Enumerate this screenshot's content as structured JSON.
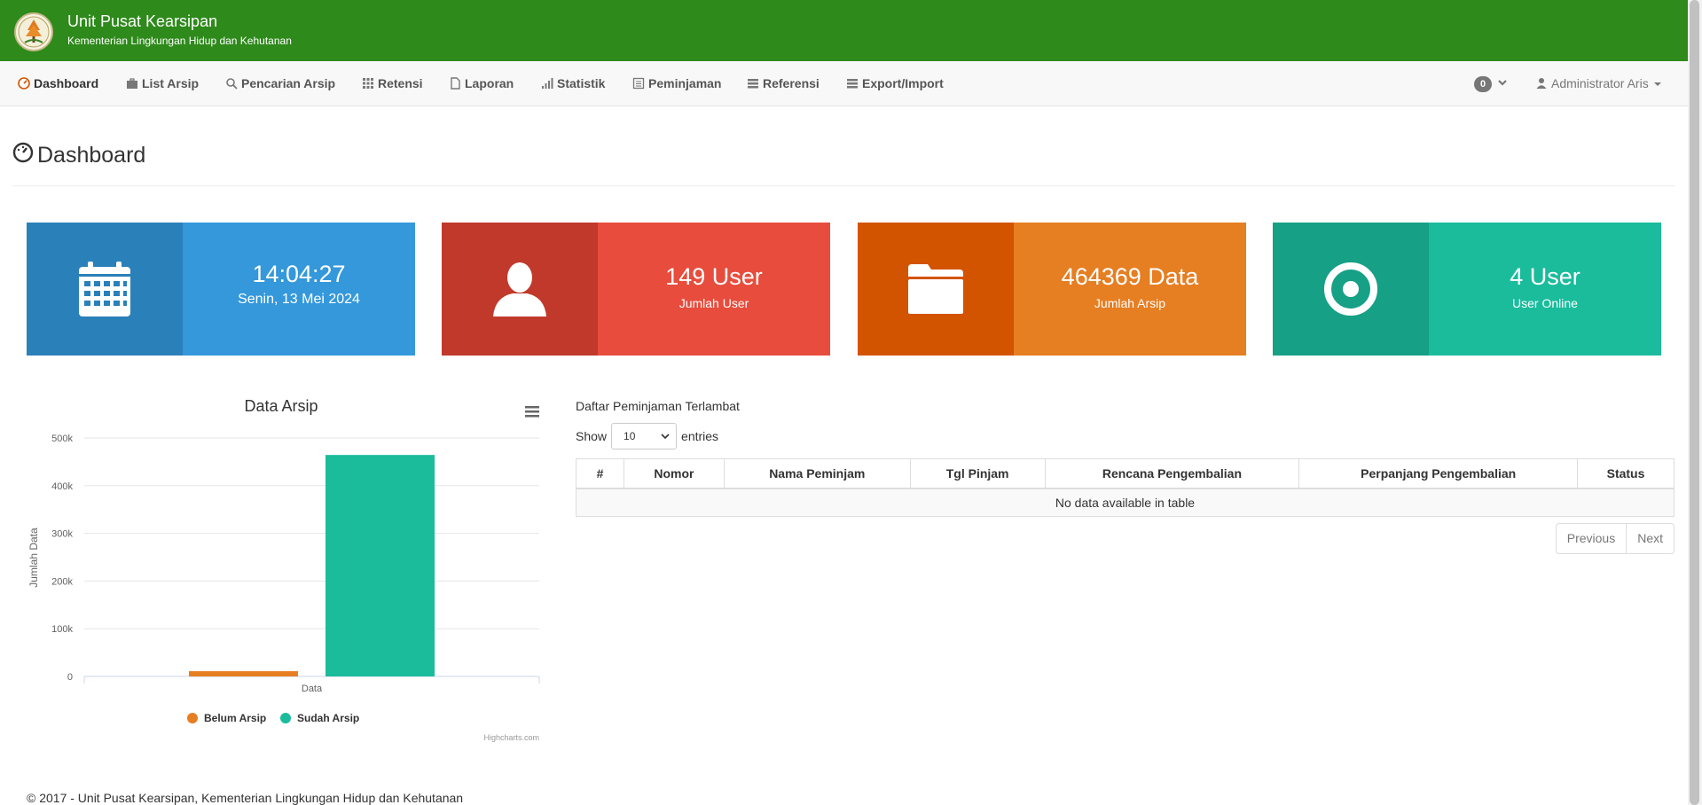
{
  "header": {
    "title": "Unit Pusat Kearsipan",
    "subtitle": "Kementerian Lingkungan Hidup dan Kehutanan"
  },
  "nav": {
    "items": [
      {
        "label": "Dashboard",
        "icon": "dashboard-icon"
      },
      {
        "label": "List Arsip",
        "icon": "briefcase-icon"
      },
      {
        "label": "Pencarian Arsip",
        "icon": "search-icon"
      },
      {
        "label": "Retensi",
        "icon": "grid-icon"
      },
      {
        "label": "Laporan",
        "icon": "file-icon"
      },
      {
        "label": "Statistik",
        "icon": "signal-icon"
      },
      {
        "label": "Peminjaman",
        "icon": "list-alt-icon"
      },
      {
        "label": "Referensi",
        "icon": "tasks-icon"
      },
      {
        "label": "Export/Import",
        "icon": "tasks-icon"
      }
    ],
    "notifications_count": "0",
    "user_label": "Administrator Aris"
  },
  "page": {
    "title": "Dashboard"
  },
  "cards": [
    {
      "value": "14:04:27",
      "label": "Senin, 13 Mei 2024",
      "icon": "calendar-icon",
      "color_dark": "#2a80b9",
      "color": "#3498db"
    },
    {
      "value": "149 User",
      "label": "Jumlah User",
      "icon": "user-icon",
      "color_dark": "#c0392b",
      "color": "#e74c3c"
    },
    {
      "value": "464369 Data",
      "label": "Jumlah Arsip",
      "icon": "folder-icon",
      "color_dark": "#d35400",
      "color": "#e67e22"
    },
    {
      "value": "4 User",
      "label": "User Online",
      "icon": "record-icon",
      "color_dark": "#16a085",
      "color": "#1abc9c"
    }
  ],
  "chart_data": {
    "type": "bar",
    "title": "Data Arsip",
    "categories": [
      "Data"
    ],
    "series": [
      {
        "name": "Belum Arsip",
        "values": [
          11000
        ],
        "color": "#e67e22"
      },
      {
        "name": "Sudah Arsip",
        "values": [
          464369
        ],
        "color": "#1abc9c"
      }
    ],
    "xlabel": "",
    "ylabel": "Jumlah Data",
    "ylim": [
      0,
      500000
    ],
    "yticks": [
      "0",
      "100k",
      "200k",
      "300k",
      "400k",
      "500k"
    ],
    "grid": true,
    "legend": "bottom",
    "credits": "Highcharts.com"
  },
  "table": {
    "title": "Daftar Peminjaman Terlambat",
    "show_label": "Show",
    "entries_value": "10",
    "entries_label": "entries",
    "columns": [
      "#",
      "Nomor",
      "Nama Peminjam",
      "Tgl Pinjam",
      "Rencana Pengembalian",
      "Perpanjang Pengembalian",
      "Status"
    ],
    "empty_text": "No data available in table",
    "prev_label": "Previous",
    "next_label": "Next"
  },
  "footer": {
    "text": "© 2017 - Unit Pusat Kearsipan, Kementerian Lingkungan Hidup dan Kehutanan"
  }
}
